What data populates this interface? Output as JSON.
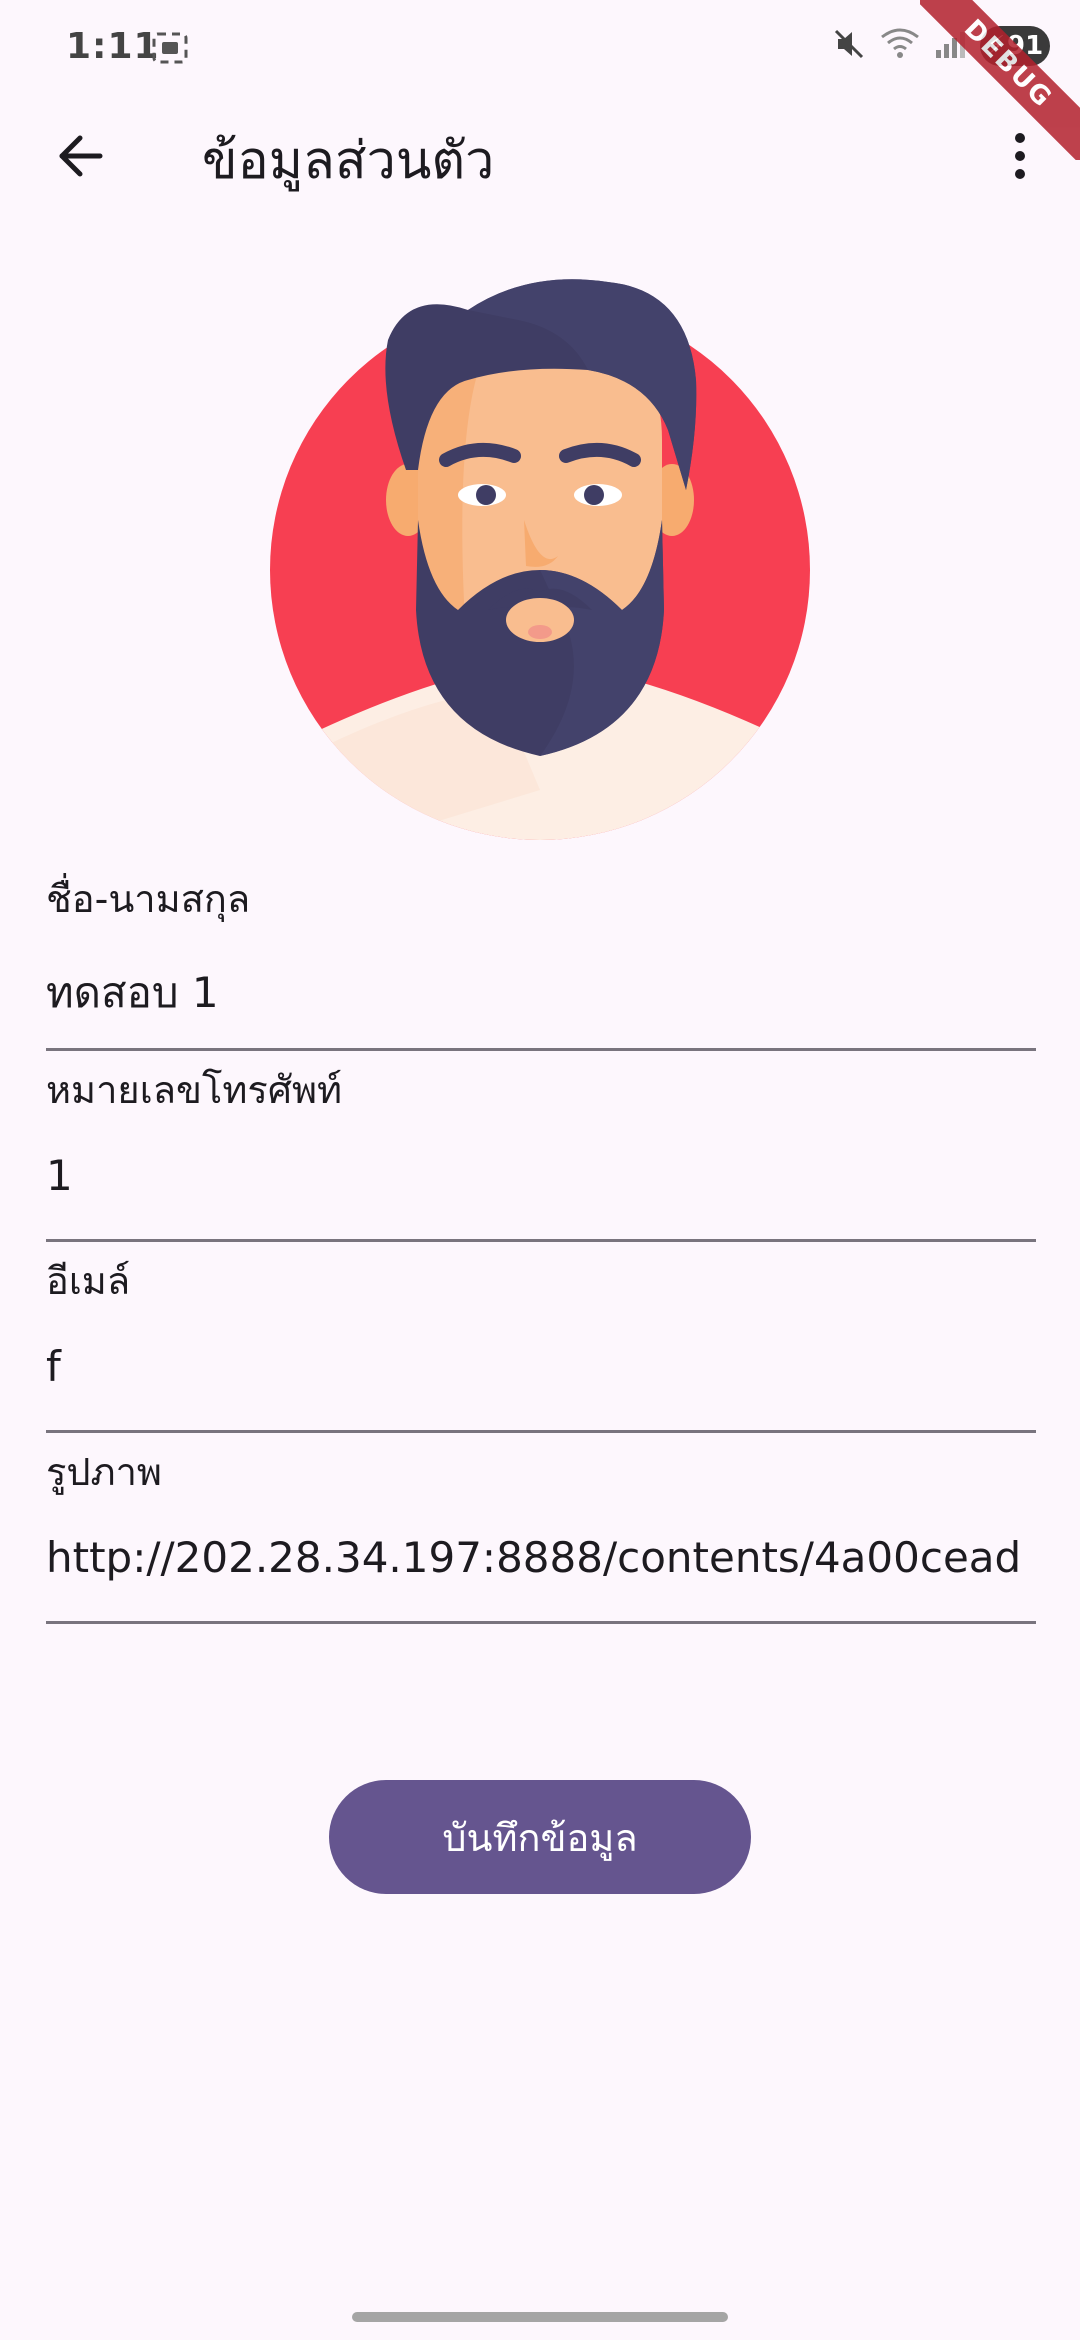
{
  "status_bar": {
    "time": "1:11",
    "battery": "91"
  },
  "debug_banner": "DEBUG",
  "app_bar": {
    "title": "ข้อมูลส่วนตัว"
  },
  "avatar": {
    "colors": {
      "background": "#f73f52",
      "hair": "#3f3d64",
      "skin": "#f9bd8f",
      "shirt": "#fdeee4"
    }
  },
  "form": {
    "fields": [
      {
        "label": "ชื่อ-นามสกุล",
        "value": "ทดสอบ 1"
      },
      {
        "label": "หมายเลขโทรศัพท์",
        "value": "1"
      },
      {
        "label": "อีเมล์",
        "value": "f"
      },
      {
        "label": "รูปภาพ",
        "value": "http://202.28.34.197:8888/contents/4a00cead"
      }
    ]
  },
  "save_button": {
    "label": "บันทึกข้อมูล"
  },
  "colors": {
    "background": "#fdf7fd",
    "primary_button": "#65558f",
    "divider": "#79747e"
  },
  "icons": {
    "back": "arrow-left-icon",
    "more": "more-vert-icon",
    "mute": "volume-mute-icon",
    "wifi": "wifi-icon",
    "signal": "signal-icon",
    "screenshot": "screenshot-icon"
  }
}
